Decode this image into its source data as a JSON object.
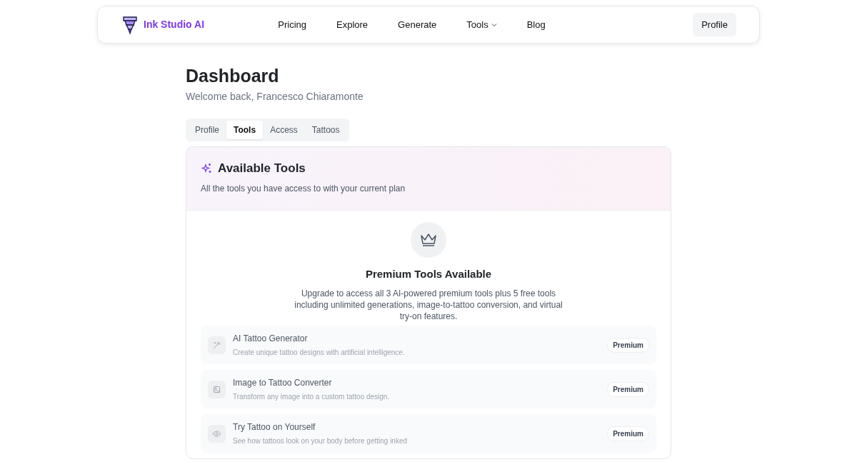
{
  "navbar": {
    "brand": "Ink Studio AI",
    "links": [
      {
        "label": "Pricing",
        "dropdown": false
      },
      {
        "label": "Explore",
        "dropdown": false
      },
      {
        "label": "Generate",
        "dropdown": false
      },
      {
        "label": "Tools",
        "dropdown": true
      },
      {
        "label": "Blog",
        "dropdown": false
      }
    ],
    "profile_button": "Profile"
  },
  "page": {
    "title": "Dashboard",
    "subtitle": "Welcome back, Francesco Chiaramonte"
  },
  "tabs": [
    {
      "label": "Profile",
      "selected": false
    },
    {
      "label": "Tools",
      "selected": true
    },
    {
      "label": "Access",
      "selected": false
    },
    {
      "label": "Tattoos",
      "selected": false
    }
  ],
  "card": {
    "title": "Available Tools",
    "subtitle": "All the tools you have access to with your current plan",
    "upgrade": {
      "heading": "Premium Tools Available",
      "text": "Upgrade to access all 3 AI-powered premium tools plus 5 free tools including unlimited generations, image-to-tattoo conversion, and virtual try-on features."
    },
    "tools": [
      {
        "kind": "wand",
        "name": "AI Tattoo Generator",
        "description": "Create unique tattoo designs with artificial intelligence.",
        "badge": "Premium"
      },
      {
        "kind": "image",
        "name": "Image to Tattoo Converter",
        "description": "Transform any image into a custom tattoo design.",
        "badge": "Premium"
      },
      {
        "kind": "eye",
        "name": "Try Tattoo on Yourself",
        "description": "See how tattoos look on your body before getting inked",
        "badge": "Premium"
      }
    ]
  }
}
